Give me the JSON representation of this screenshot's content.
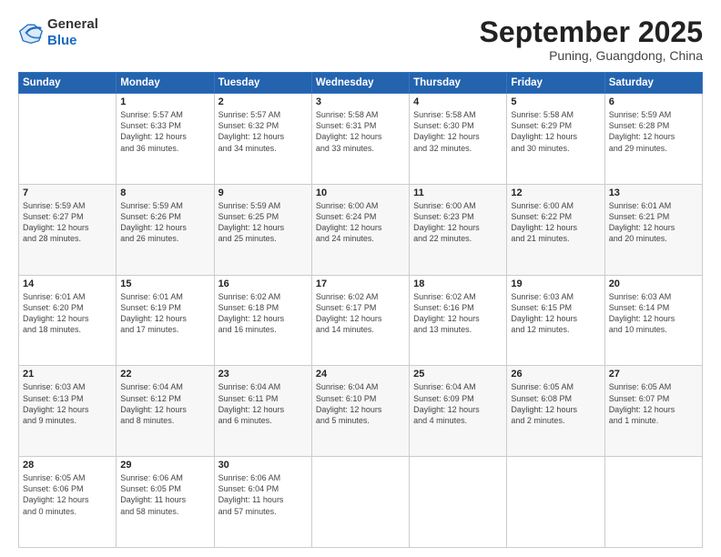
{
  "header": {
    "logo_general": "General",
    "logo_blue": "Blue",
    "month_title": "September 2025",
    "location": "Puning, Guangdong, China"
  },
  "weekdays": [
    "Sunday",
    "Monday",
    "Tuesday",
    "Wednesday",
    "Thursday",
    "Friday",
    "Saturday"
  ],
  "weeks": [
    [
      {
        "day": "",
        "info": ""
      },
      {
        "day": "1",
        "info": "Sunrise: 5:57 AM\nSunset: 6:33 PM\nDaylight: 12 hours\nand 36 minutes."
      },
      {
        "day": "2",
        "info": "Sunrise: 5:57 AM\nSunset: 6:32 PM\nDaylight: 12 hours\nand 34 minutes."
      },
      {
        "day": "3",
        "info": "Sunrise: 5:58 AM\nSunset: 6:31 PM\nDaylight: 12 hours\nand 33 minutes."
      },
      {
        "day": "4",
        "info": "Sunrise: 5:58 AM\nSunset: 6:30 PM\nDaylight: 12 hours\nand 32 minutes."
      },
      {
        "day": "5",
        "info": "Sunrise: 5:58 AM\nSunset: 6:29 PM\nDaylight: 12 hours\nand 30 minutes."
      },
      {
        "day": "6",
        "info": "Sunrise: 5:59 AM\nSunset: 6:28 PM\nDaylight: 12 hours\nand 29 minutes."
      }
    ],
    [
      {
        "day": "7",
        "info": "Sunrise: 5:59 AM\nSunset: 6:27 PM\nDaylight: 12 hours\nand 28 minutes."
      },
      {
        "day": "8",
        "info": "Sunrise: 5:59 AM\nSunset: 6:26 PM\nDaylight: 12 hours\nand 26 minutes."
      },
      {
        "day": "9",
        "info": "Sunrise: 5:59 AM\nSunset: 6:25 PM\nDaylight: 12 hours\nand 25 minutes."
      },
      {
        "day": "10",
        "info": "Sunrise: 6:00 AM\nSunset: 6:24 PM\nDaylight: 12 hours\nand 24 minutes."
      },
      {
        "day": "11",
        "info": "Sunrise: 6:00 AM\nSunset: 6:23 PM\nDaylight: 12 hours\nand 22 minutes."
      },
      {
        "day": "12",
        "info": "Sunrise: 6:00 AM\nSunset: 6:22 PM\nDaylight: 12 hours\nand 21 minutes."
      },
      {
        "day": "13",
        "info": "Sunrise: 6:01 AM\nSunset: 6:21 PM\nDaylight: 12 hours\nand 20 minutes."
      }
    ],
    [
      {
        "day": "14",
        "info": "Sunrise: 6:01 AM\nSunset: 6:20 PM\nDaylight: 12 hours\nand 18 minutes."
      },
      {
        "day": "15",
        "info": "Sunrise: 6:01 AM\nSunset: 6:19 PM\nDaylight: 12 hours\nand 17 minutes."
      },
      {
        "day": "16",
        "info": "Sunrise: 6:02 AM\nSunset: 6:18 PM\nDaylight: 12 hours\nand 16 minutes."
      },
      {
        "day": "17",
        "info": "Sunrise: 6:02 AM\nSunset: 6:17 PM\nDaylight: 12 hours\nand 14 minutes."
      },
      {
        "day": "18",
        "info": "Sunrise: 6:02 AM\nSunset: 6:16 PM\nDaylight: 12 hours\nand 13 minutes."
      },
      {
        "day": "19",
        "info": "Sunrise: 6:03 AM\nSunset: 6:15 PM\nDaylight: 12 hours\nand 12 minutes."
      },
      {
        "day": "20",
        "info": "Sunrise: 6:03 AM\nSunset: 6:14 PM\nDaylight: 12 hours\nand 10 minutes."
      }
    ],
    [
      {
        "day": "21",
        "info": "Sunrise: 6:03 AM\nSunset: 6:13 PM\nDaylight: 12 hours\nand 9 minutes."
      },
      {
        "day": "22",
        "info": "Sunrise: 6:04 AM\nSunset: 6:12 PM\nDaylight: 12 hours\nand 8 minutes."
      },
      {
        "day": "23",
        "info": "Sunrise: 6:04 AM\nSunset: 6:11 PM\nDaylight: 12 hours\nand 6 minutes."
      },
      {
        "day": "24",
        "info": "Sunrise: 6:04 AM\nSunset: 6:10 PM\nDaylight: 12 hours\nand 5 minutes."
      },
      {
        "day": "25",
        "info": "Sunrise: 6:04 AM\nSunset: 6:09 PM\nDaylight: 12 hours\nand 4 minutes."
      },
      {
        "day": "26",
        "info": "Sunrise: 6:05 AM\nSunset: 6:08 PM\nDaylight: 12 hours\nand 2 minutes."
      },
      {
        "day": "27",
        "info": "Sunrise: 6:05 AM\nSunset: 6:07 PM\nDaylight: 12 hours\nand 1 minute."
      }
    ],
    [
      {
        "day": "28",
        "info": "Sunrise: 6:05 AM\nSunset: 6:06 PM\nDaylight: 12 hours\nand 0 minutes."
      },
      {
        "day": "29",
        "info": "Sunrise: 6:06 AM\nSunset: 6:05 PM\nDaylight: 11 hours\nand 58 minutes."
      },
      {
        "day": "30",
        "info": "Sunrise: 6:06 AM\nSunset: 6:04 PM\nDaylight: 11 hours\nand 57 minutes."
      },
      {
        "day": "",
        "info": ""
      },
      {
        "day": "",
        "info": ""
      },
      {
        "day": "",
        "info": ""
      },
      {
        "day": "",
        "info": ""
      }
    ]
  ]
}
